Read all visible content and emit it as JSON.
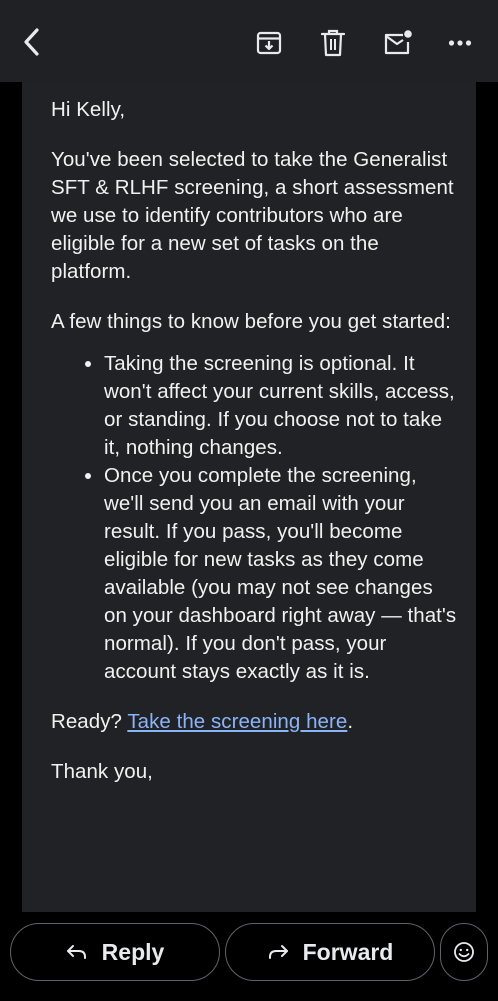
{
  "toolbar": {
    "back_icon": "chevron-left-icon",
    "archive_icon": "archive-icon",
    "delete_icon": "trash-icon",
    "unread_icon": "mark-unread-icon",
    "more_icon": "more-horizontal-icon"
  },
  "email": {
    "greeting": "Hi Kelly,",
    "para1": "You've been selected to take the Generalist SFT & RLHF screening, a short assessment we use to identify contributors who are eligible for a new set of tasks on the platform.",
    "para2": "A few things to know before you get started:",
    "bullets": [
      "Taking the screening is optional. It won't affect your current skills, access, or standing. If you choose not to take it, nothing changes.",
      "Once you complete the screening, we'll send you an email with your result. If you pass, you'll become eligible for new tasks as they come available (you may not see changes on your dashboard right away — that's normal). If you don't pass, your account stays exactly as it is."
    ],
    "ready_prefix": "Ready? ",
    "ready_link": "Take the screening here",
    "ready_suffix": ".",
    "closing": "Thank you,"
  },
  "actions": {
    "reply_label": "Reply",
    "forward_label": "Forward",
    "emoji_icon": "emoji-smile-icon"
  },
  "colors": {
    "background": "#000000",
    "toolbar": "#202124",
    "card": "#212226",
    "link": "#8ab4f8",
    "border": "#5f6368"
  }
}
